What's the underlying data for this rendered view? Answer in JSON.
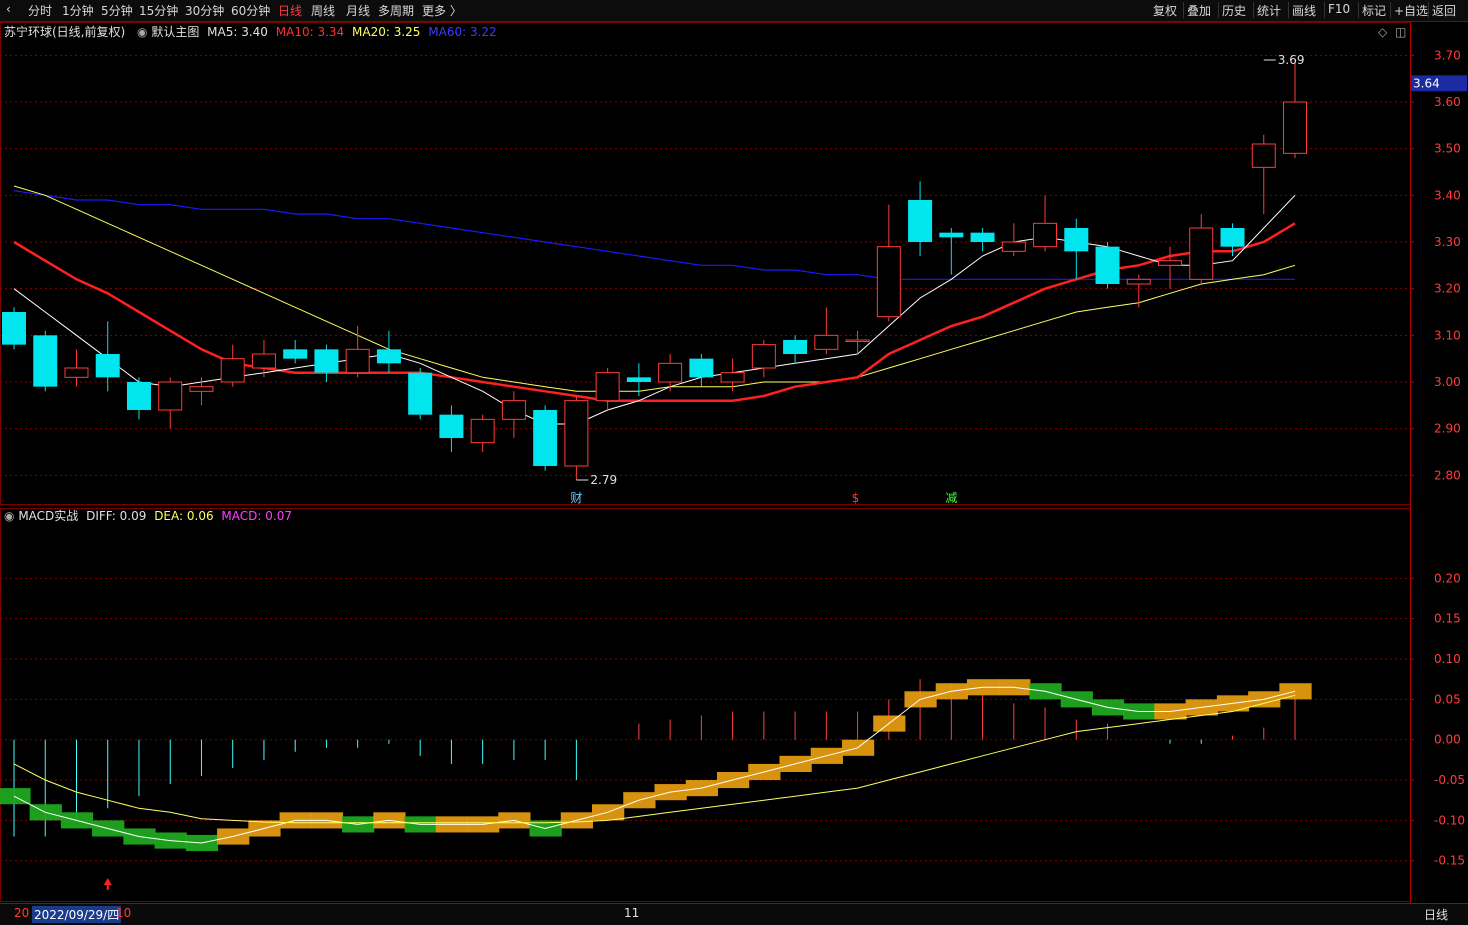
{
  "toolbar": {
    "left": [
      {
        "label": "分时",
        "active": false
      },
      {
        "label": "1分钟",
        "active": false
      },
      {
        "label": "5分钟",
        "active": false
      },
      {
        "label": "15分钟",
        "active": false
      },
      {
        "label": "30分钟",
        "active": false
      },
      {
        "label": "60分钟",
        "active": false
      },
      {
        "label": "日线",
        "active": true
      },
      {
        "label": "周线",
        "active": false
      },
      {
        "label": "月线",
        "active": false
      },
      {
        "label": "多周期",
        "active": false
      },
      {
        "label": "更多 〉",
        "active": false
      }
    ],
    "right": [
      "复权",
      "叠加",
      "历史",
      "统计",
      "画线",
      "F10",
      "标记",
      "+自选",
      "返回"
    ]
  },
  "legend": {
    "stock": "苏宁环球(日线,前复权)",
    "template": "默认主图",
    "ma5": "MA5: 3.40",
    "ma10": "MA10: 3.34",
    "ma20": "MA20: 3.25",
    "ma60": "MA60: 3.22"
  },
  "macd_legend": {
    "name": "MACD实战",
    "diff": "DIFF: 0.09",
    "dea": "DEA: 0.06",
    "macd": "MACD: 0.07"
  },
  "status": {
    "date": "2022/09/29/四",
    "month_left": "20",
    "month_tick": "10",
    "month_tick2": "11",
    "period": "日线"
  },
  "colors": {
    "up": "#ff3b3b",
    "down": "#00e5ee",
    "ma5": "#ffffff",
    "ma10": "#ff2020",
    "ma20": "#ffff60",
    "ma60": "#1a1aff",
    "dea": "#ffff60",
    "macd": "#ff40ff",
    "grid": "#8b0000"
  },
  "chart_data": [
    {
      "type": "candlestick",
      "title": "苏宁环球(日线,前复权)",
      "ylim": [
        2.76,
        3.72
      ],
      "yticks": [
        2.8,
        2.9,
        3.0,
        3.1,
        3.2,
        3.3,
        3.4,
        3.5,
        3.6,
        3.7
      ],
      "last_price": 3.64,
      "annotations": [
        {
          "label": "3.69",
          "index": 40,
          "value": 3.69
        },
        {
          "label": "2.79",
          "index": 18,
          "value": 2.79
        }
      ],
      "markers": [
        {
          "label": "财",
          "index": 18,
          "color": "#6ecbff"
        },
        {
          "label": "$",
          "index": 27,
          "color": "#ff3b3b"
        },
        {
          "label": "减",
          "index": 30,
          "color": "#40ff40"
        }
      ],
      "candles": [
        [
          3.15,
          3.08,
          3.16,
          3.07
        ],
        [
          3.1,
          2.99,
          3.11,
          2.98
        ],
        [
          3.01,
          3.03,
          3.07,
          2.99
        ],
        [
          3.06,
          3.01,
          3.13,
          2.98
        ],
        [
          3.0,
          2.94,
          3.01,
          2.92
        ],
        [
          2.94,
          3.0,
          3.01,
          2.9
        ],
        [
          2.98,
          2.99,
          3.01,
          2.95
        ],
        [
          3.0,
          3.05,
          3.08,
          2.99
        ],
        [
          3.03,
          3.06,
          3.09,
          3.01
        ],
        [
          3.07,
          3.05,
          3.09,
          3.04
        ],
        [
          3.07,
          3.02,
          3.08,
          3.0
        ],
        [
          3.02,
          3.07,
          3.12,
          3.01
        ],
        [
          3.07,
          3.04,
          3.11,
          3.02
        ],
        [
          3.02,
          2.93,
          3.03,
          2.92
        ],
        [
          2.93,
          2.88,
          2.95,
          2.85
        ],
        [
          2.87,
          2.92,
          2.93,
          2.85
        ],
        [
          2.92,
          2.96,
          2.98,
          2.88
        ],
        [
          2.94,
          2.82,
          2.95,
          2.81
        ],
        [
          2.82,
          2.96,
          2.97,
          2.79
        ],
        [
          2.96,
          3.02,
          3.03,
          2.94
        ],
        [
          3.01,
          3.0,
          3.04,
          2.97
        ],
        [
          3.0,
          3.04,
          3.06,
          2.98
        ],
        [
          3.05,
          3.01,
          3.06,
          2.99
        ],
        [
          3.0,
          3.02,
          3.05,
          2.98
        ],
        [
          3.03,
          3.08,
          3.09,
          3.01
        ],
        [
          3.09,
          3.06,
          3.1,
          3.04
        ],
        [
          3.07,
          3.1,
          3.16,
          3.06
        ],
        [
          3.09,
          3.09,
          3.11,
          3.06
        ],
        [
          3.14,
          3.29,
          3.38,
          3.13
        ],
        [
          3.39,
          3.3,
          3.43,
          3.27
        ],
        [
          3.32,
          3.31,
          3.33,
          3.23
        ],
        [
          3.32,
          3.3,
          3.33,
          3.28
        ],
        [
          3.28,
          3.3,
          3.34,
          3.27
        ],
        [
          3.29,
          3.34,
          3.4,
          3.28
        ],
        [
          3.33,
          3.28,
          3.35,
          3.22
        ],
        [
          3.29,
          3.21,
          3.3,
          3.2
        ],
        [
          3.21,
          3.22,
          3.23,
          3.16
        ],
        [
          3.25,
          3.26,
          3.29,
          3.2
        ],
        [
          3.22,
          3.33,
          3.36,
          3.21
        ],
        [
          3.33,
          3.29,
          3.34,
          3.27
        ],
        [
          3.46,
          3.51,
          3.53,
          3.36
        ],
        [
          3.49,
          3.6,
          3.69,
          3.48
        ]
      ],
      "ma5": [
        3.2,
        3.15,
        3.1,
        3.05,
        3.0,
        2.99,
        3.0,
        3.01,
        3.02,
        3.03,
        3.04,
        3.05,
        3.06,
        3.04,
        3.01,
        2.98,
        2.94,
        2.91,
        2.91,
        2.94,
        2.96,
        2.99,
        3.01,
        3.02,
        3.03,
        3.04,
        3.05,
        3.06,
        3.12,
        3.18,
        3.22,
        3.27,
        3.3,
        3.31,
        3.3,
        3.29,
        3.27,
        3.25,
        3.25,
        3.26,
        3.33,
        3.4
      ],
      "ma10": [
        3.3,
        3.26,
        3.22,
        3.19,
        3.15,
        3.11,
        3.07,
        3.04,
        3.03,
        3.02,
        3.02,
        3.02,
        3.02,
        3.02,
        3.01,
        3.0,
        2.99,
        2.98,
        2.97,
        2.96,
        2.96,
        2.96,
        2.96,
        2.96,
        2.97,
        2.99,
        3.0,
        3.01,
        3.06,
        3.09,
        3.12,
        3.14,
        3.17,
        3.2,
        3.22,
        3.24,
        3.25,
        3.27,
        3.28,
        3.28,
        3.3,
        3.34
      ],
      "ma20": [
        3.42,
        3.4,
        3.37,
        3.34,
        3.31,
        3.28,
        3.25,
        3.22,
        3.19,
        3.16,
        3.13,
        3.1,
        3.07,
        3.05,
        3.03,
        3.01,
        3.0,
        2.99,
        2.98,
        2.98,
        2.98,
        2.99,
        2.99,
        2.99,
        3.0,
        3.0,
        3.0,
        3.01,
        3.03,
        3.05,
        3.07,
        3.09,
        3.11,
        3.13,
        3.15,
        3.16,
        3.17,
        3.19,
        3.21,
        3.22,
        3.23,
        3.25
      ],
      "ma60": [
        3.41,
        3.4,
        3.39,
        3.39,
        3.38,
        3.38,
        3.37,
        3.37,
        3.37,
        3.36,
        3.36,
        3.35,
        3.35,
        3.34,
        3.33,
        3.32,
        3.31,
        3.3,
        3.29,
        3.28,
        3.27,
        3.26,
        3.25,
        3.25,
        3.24,
        3.24,
        3.23,
        3.23,
        3.22,
        3.22,
        3.22,
        3.22,
        3.22,
        3.22,
        3.22,
        3.22,
        3.22,
        3.22,
        3.22,
        3.22,
        3.22,
        3.22
      ]
    },
    {
      "type": "macd",
      "title": "MACD实战",
      "ylim": [
        -0.19,
        0.25
      ],
      "yticks": [
        -0.15,
        -0.1,
        -0.05,
        0.0,
        0.05,
        0.1,
        0.15,
        0.2
      ],
      "diff": [
        -0.07,
        -0.09,
        -0.1,
        -0.11,
        -0.12,
        -0.125,
        -0.128,
        -0.12,
        -0.11,
        -0.1,
        -0.1,
        -0.105,
        -0.1,
        -0.105,
        -0.105,
        -0.105,
        -0.1,
        -0.11,
        -0.1,
        -0.09,
        -0.075,
        -0.065,
        -0.06,
        -0.05,
        -0.04,
        -0.03,
        -0.02,
        -0.01,
        0.02,
        0.05,
        0.06,
        0.065,
        0.065,
        0.06,
        0.05,
        0.04,
        0.035,
        0.035,
        0.04,
        0.045,
        0.05,
        0.06
      ],
      "dea": [
        -0.03,
        -0.05,
        -0.065,
        -0.075,
        -0.085,
        -0.09,
        -0.098,
        -0.1,
        -0.102,
        -0.103,
        -0.103,
        -0.103,
        -0.103,
        -0.103,
        -0.103,
        -0.103,
        -0.103,
        -0.103,
        -0.102,
        -0.1,
        -0.095,
        -0.09,
        -0.085,
        -0.08,
        -0.075,
        -0.07,
        -0.065,
        -0.06,
        -0.05,
        -0.04,
        -0.03,
        -0.02,
        -0.01,
        0.0,
        0.01,
        0.015,
        0.02,
        0.025,
        0.03,
        0.035,
        0.045,
        0.055
      ],
      "macd": [
        -0.12,
        -0.12,
        -0.1,
        -0.085,
        -0.07,
        -0.055,
        -0.045,
        -0.035,
        -0.025,
        -0.015,
        -0.01,
        -0.01,
        -0.005,
        -0.02,
        -0.03,
        -0.03,
        -0.025,
        -0.025,
        -0.05,
        0.0,
        0.02,
        0.025,
        0.03,
        0.035,
        0.035,
        0.035,
        0.035,
        0.035,
        0.05,
        0.075,
        0.07,
        0.055,
        0.045,
        0.04,
        0.025,
        0.02,
        0.0,
        -0.005,
        -0.005,
        0.005,
        0.015,
        0.06
      ]
    }
  ]
}
